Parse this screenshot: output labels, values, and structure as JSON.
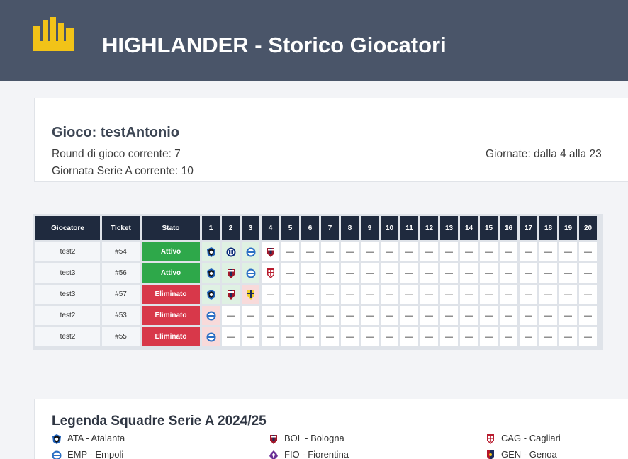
{
  "header": {
    "title": "HIGHLANDER - Storico Giocatori"
  },
  "game": {
    "title": "Gioco: testAntonio",
    "round_current": "Round di gioco corrente: 7",
    "seriea_current": "Giornata Serie A corrente: 10",
    "giornate": "Giornate: dalla 4 alla 23"
  },
  "table": {
    "headers": {
      "player": "Giocatore",
      "ticket": "Ticket",
      "status": "Stato"
    },
    "rounds": [
      "1",
      "2",
      "3",
      "4",
      "5",
      "6",
      "7",
      "8",
      "9",
      "10",
      "11",
      "12",
      "13",
      "14",
      "15",
      "16",
      "17",
      "18",
      "19",
      "20"
    ],
    "empty_mark": "—",
    "rows": [
      {
        "player": "test2",
        "ticket": "#54",
        "status": "Attivo",
        "picks": [
          {
            "team": "ATA",
            "result": "win"
          },
          {
            "team": "INT",
            "result": "win"
          },
          {
            "team": "EMP",
            "result": "win"
          },
          {
            "team": "BOL",
            "result": "none"
          }
        ]
      },
      {
        "player": "test3",
        "ticket": "#56",
        "status": "Attivo",
        "picks": [
          {
            "team": "ATA",
            "result": "win"
          },
          {
            "team": "BOL",
            "result": "win"
          },
          {
            "team": "EMP",
            "result": "win"
          },
          {
            "team": "CAG",
            "result": "none"
          }
        ]
      },
      {
        "player": "test3",
        "ticket": "#57",
        "status": "Eliminato",
        "picks": [
          {
            "team": "ATA",
            "result": "win"
          },
          {
            "team": "BOL",
            "result": "win"
          },
          {
            "team": "PAR",
            "result": "lose"
          }
        ]
      },
      {
        "player": "test2",
        "ticket": "#53",
        "status": "Eliminato",
        "picks": [
          {
            "team": "EMP",
            "result": "lose"
          }
        ]
      },
      {
        "player": "test2",
        "ticket": "#55",
        "status": "Eliminato",
        "picks": [
          {
            "team": "EMP",
            "result": "lose"
          }
        ]
      }
    ]
  },
  "legend": {
    "title": "Legenda Squadre Serie A 2024/25",
    "items": [
      {
        "team": "ATA",
        "label": "ATA - Atalanta"
      },
      {
        "team": "BOL",
        "label": "BOL - Bologna"
      },
      {
        "team": "CAG",
        "label": "CAG - Cagliari"
      },
      {
        "team": "EMP",
        "label": "EMP - Empoli"
      },
      {
        "team": "FIO",
        "label": "FIO - Fiorentina"
      },
      {
        "team": "GEN",
        "label": "GEN - Genoa"
      }
    ]
  },
  "colors": {
    "header_bg": "#4a5569",
    "logo": "#f2c318",
    "table_head": "#1f2a3e",
    "active": "#2ea84a",
    "eliminated": "#d8384a",
    "win_cell": "#dff1e3",
    "lose_cell": "#f8dada"
  },
  "icons": {
    "logo": "highlander-crown-icon",
    "ATA": "atalanta-crest-icon",
    "INT": "inter-crest-icon",
    "EMP": "empoli-crest-icon",
    "BOL": "bologna-crest-icon",
    "CAG": "cagliari-crest-icon",
    "PAR": "parma-crest-icon",
    "FIO": "fiorentina-crest-icon",
    "GEN": "genoa-crest-icon"
  }
}
